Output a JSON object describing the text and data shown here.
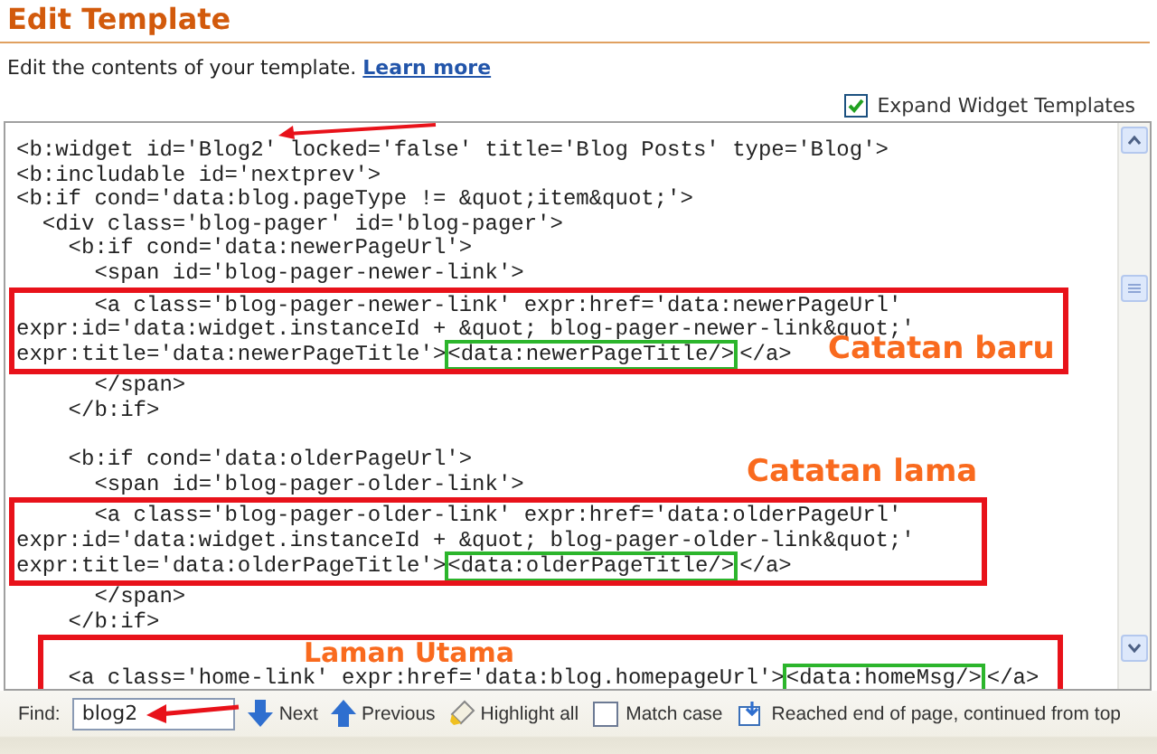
{
  "header": {
    "title": "Edit Template",
    "description": "Edit the contents of your template.",
    "link": "Learn more"
  },
  "expand_widget_templates": {
    "label": "Expand Widget Templates",
    "checked": true
  },
  "code": [
    {
      "kind": "line",
      "text": "<b:widget id='Blog2' locked='false' title='Blog Posts' type='Blog'>",
      "arrow": true
    },
    {
      "kind": "line",
      "text": "<b:includable id='nextprev'>"
    },
    {
      "kind": "line",
      "text": "<b:if cond='data:blog.pageType != &quot;item&quot;'>"
    },
    {
      "kind": "line",
      "text": "  <div class='blog-pager' id='blog-pager'>"
    },
    {
      "kind": "line",
      "text": "    <b:if cond='data:newerPageUrl'>"
    },
    {
      "kind": "line",
      "text": "      <span id='blog-pager-newer-link'>"
    },
    {
      "kind": "callout",
      "label": "Catatan baru",
      "lines": [
        {
          "text": "      <a class='blog-pager-newer-link' expr:href='data:newerPageUrl'"
        },
        {
          "text": "expr:id='data:widget.instanceId + &quot; blog-pager-newer-link&quot;'"
        },
        {
          "text": "expr:title='data:newerPageTitle'>",
          "boxed": "<data:newerPageTitle/>",
          "tail": "</a>"
        }
      ]
    },
    {
      "kind": "line",
      "text": "      </span>"
    },
    {
      "kind": "line",
      "text": "    </b:if>"
    },
    {
      "kind": "blank"
    },
    {
      "kind": "line",
      "text": "    <b:if cond='data:olderPageUrl'>"
    },
    {
      "kind": "line",
      "text": "      <span id='blog-pager-older-link'>"
    },
    {
      "kind": "callout",
      "label": "Catatan lama",
      "lines": [
        {
          "text": "      <a class='blog-pager-older-link' expr:href='data:olderPageUrl'"
        },
        {
          "text": "expr:id='data:widget.instanceId + &quot; blog-pager-older-link&quot;'"
        },
        {
          "text": "expr:title='data:olderPageTitle'>",
          "boxed": "<data:olderPageTitle/>",
          "tail": "</a>"
        }
      ]
    },
    {
      "kind": "line",
      "text": "      </span>"
    },
    {
      "kind": "line",
      "text": "    </b:if>"
    },
    {
      "kind": "callout",
      "label": "Laman Utama",
      "lines": [
        {
          "kind": "blank"
        },
        {
          "text": "    <a class='home-link' expr:href='data:blog.homepageUrl'>",
          "boxed": "<data:homeMsg/>",
          "tail": "</a>"
        }
      ]
    }
  ],
  "find_bar": {
    "label": "Find:",
    "value": "blog2",
    "arrow": true,
    "buttons": [
      {
        "kind": "next",
        "label": "Next"
      },
      {
        "kind": "previous",
        "label": "Previous"
      },
      {
        "kind": "highlight",
        "label": "Highlight all"
      }
    ],
    "match_case": {
      "label": "Match case",
      "checked": false
    },
    "status": "Reached end of page, continued from top"
  }
}
